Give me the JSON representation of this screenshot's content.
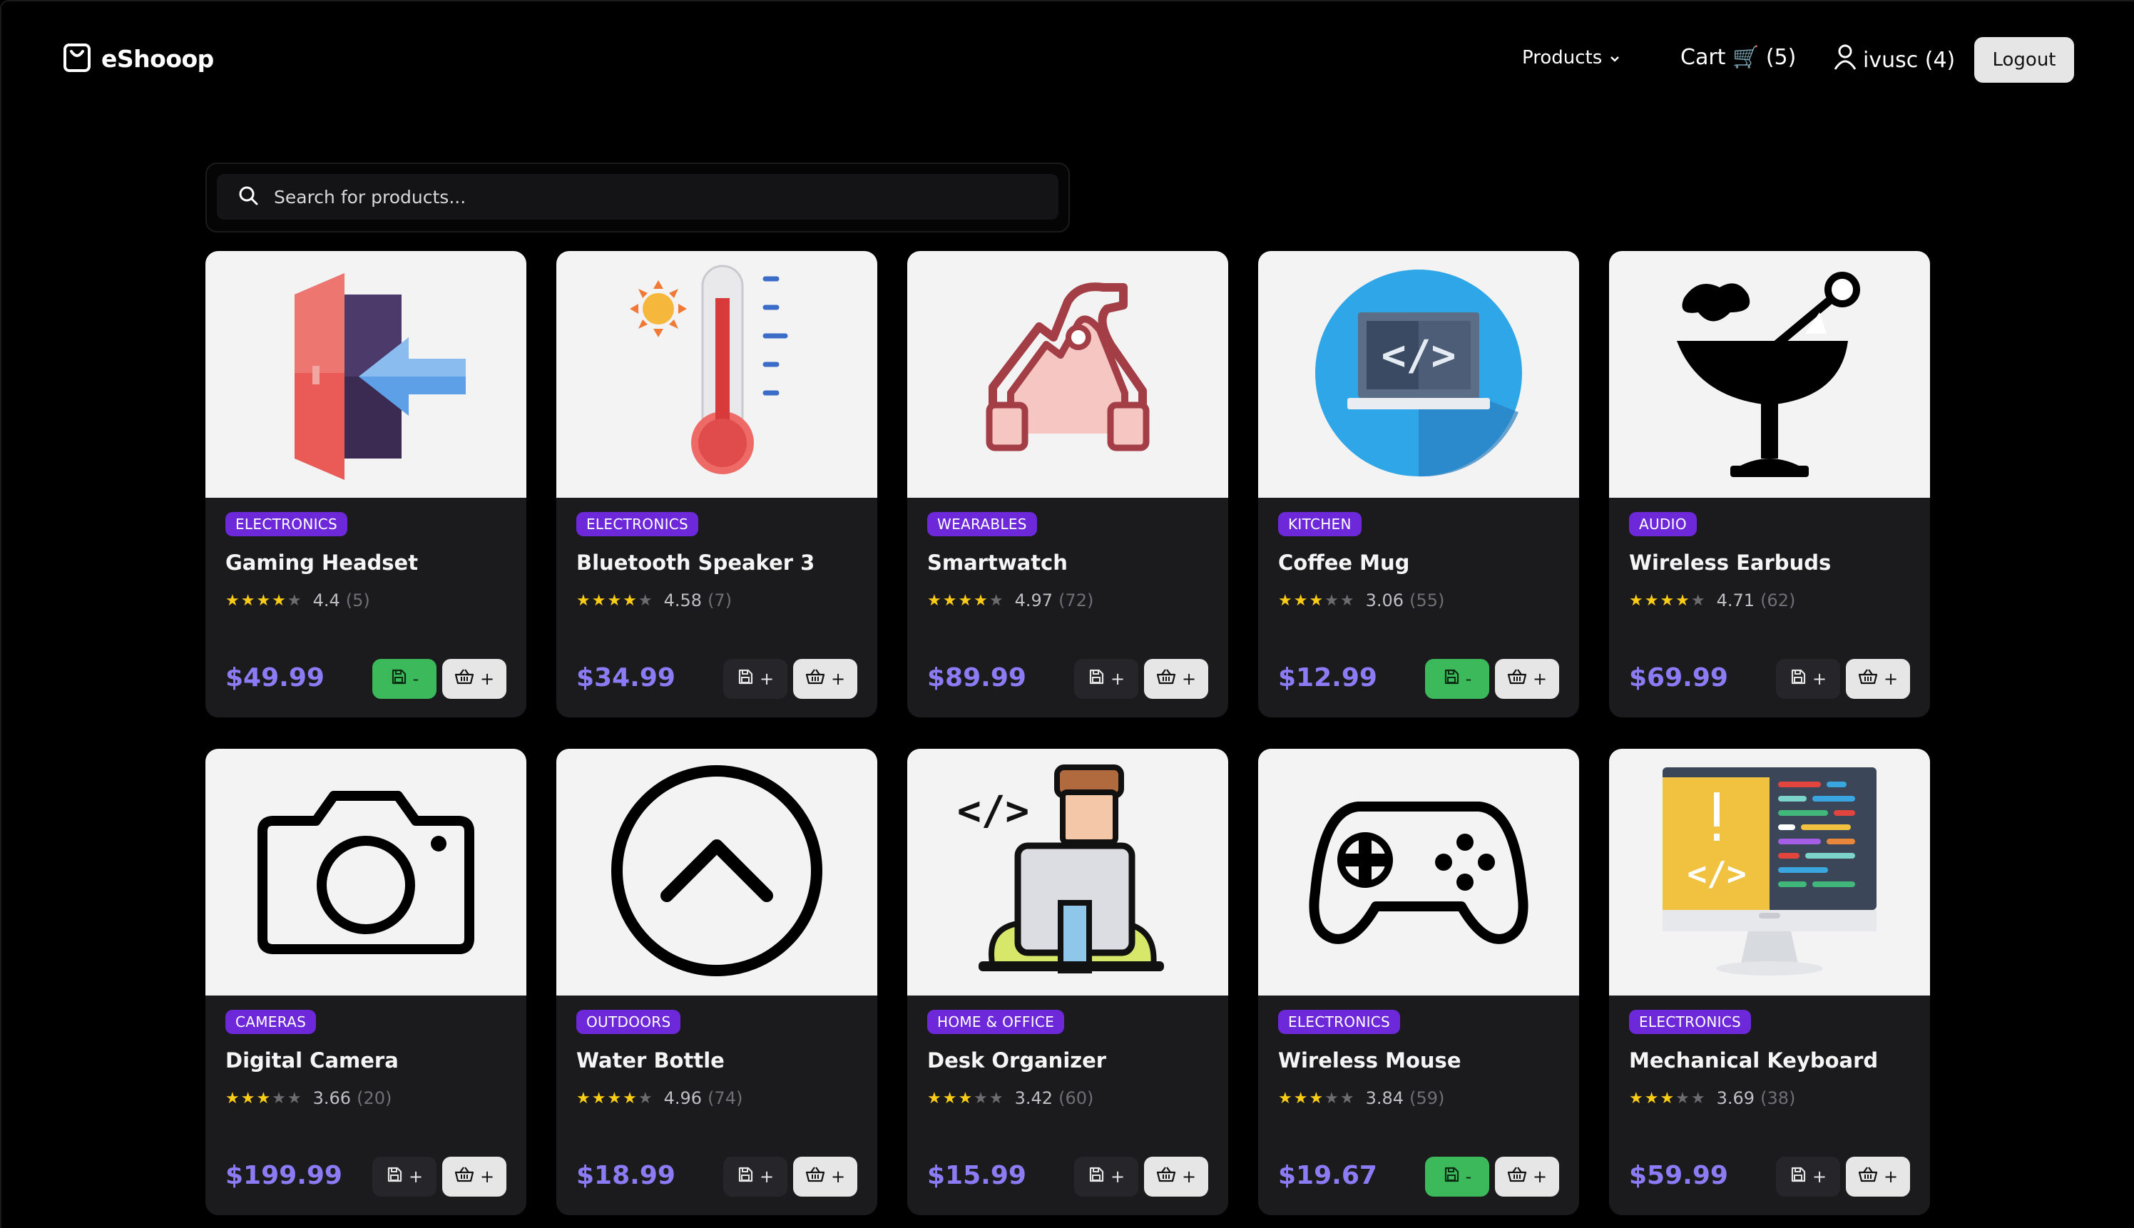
{
  "app": {
    "name": "eShooop"
  },
  "nav": {
    "products_label": "Products",
    "cart_label": "Cart 🛒 (5)",
    "user_label": "ivusc (4)",
    "logout_label": "Logout"
  },
  "search": {
    "placeholder": "Search for products..."
  },
  "buttons": {
    "add_symbol": "+",
    "remove_symbol": "-"
  },
  "colors": {
    "background": "#000000",
    "card": "#1b1b1d",
    "badge": "#6d28d9",
    "price": "#8b7cf6",
    "star": "#facc15",
    "saved_green": "#3cb95a"
  },
  "products": [
    {
      "category": "ELECTRONICS",
      "name": "Gaming Headset",
      "rating_value": "4.4",
      "rating_count": "(5)",
      "stars": 4,
      "price": "$49.99",
      "saved": true,
      "icon": "exit-door-icon"
    },
    {
      "category": "ELECTRONICS",
      "name": "Bluetooth Speaker 3",
      "rating_value": "4.58",
      "rating_count": "(7)",
      "stars": 4,
      "price": "$34.99",
      "saved": false,
      "icon": "thermometer-sun-icon"
    },
    {
      "category": "WEARABLES",
      "name": "Smartwatch",
      "rating_value": "4.97",
      "rating_count": "(72)",
      "stars": 4,
      "price": "$89.99",
      "saved": false,
      "icon": "headphones-outline-icon"
    },
    {
      "category": "KITCHEN",
      "name": "Coffee Mug",
      "rating_value": "3.06",
      "rating_count": "(55)",
      "stars": 3,
      "price": "$12.99",
      "saved": true,
      "icon": "laptop-code-icon"
    },
    {
      "category": "AUDIO",
      "name": "Wireless Earbuds",
      "rating_value": "4.71",
      "rating_count": "(62)",
      "stars": 4,
      "price": "$69.99",
      "saved": false,
      "icon": "cocktail-glass-icon"
    },
    {
      "category": "CAMERAS",
      "name": "Digital Camera",
      "rating_value": "3.66",
      "rating_count": "(20)",
      "stars": 3,
      "price": "$199.99",
      "saved": false,
      "icon": "camera-icon"
    },
    {
      "category": "OUTDOORS",
      "name": "Water Bottle",
      "rating_value": "4.96",
      "rating_count": "(74)",
      "stars": 4,
      "price": "$18.99",
      "saved": false,
      "icon": "chevron-up-circle-icon"
    },
    {
      "category": "HOME & OFFICE",
      "name": "Desk Organizer",
      "rating_value": "3.42",
      "rating_count": "(60)",
      "stars": 3,
      "price": "$15.99",
      "saved": false,
      "icon": "developer-laptop-icon"
    },
    {
      "category": "ELECTRONICS",
      "name": "Wireless Mouse",
      "rating_value": "3.84",
      "rating_count": "(59)",
      "stars": 3,
      "price": "$19.67",
      "saved": true,
      "icon": "gamepad-icon"
    },
    {
      "category": "ELECTRONICS",
      "name": "Mechanical Keyboard",
      "rating_value": "3.69",
      "rating_count": "(38)",
      "stars": 3,
      "price": "$59.99",
      "saved": false,
      "icon": "monitor-code-icon"
    }
  ]
}
